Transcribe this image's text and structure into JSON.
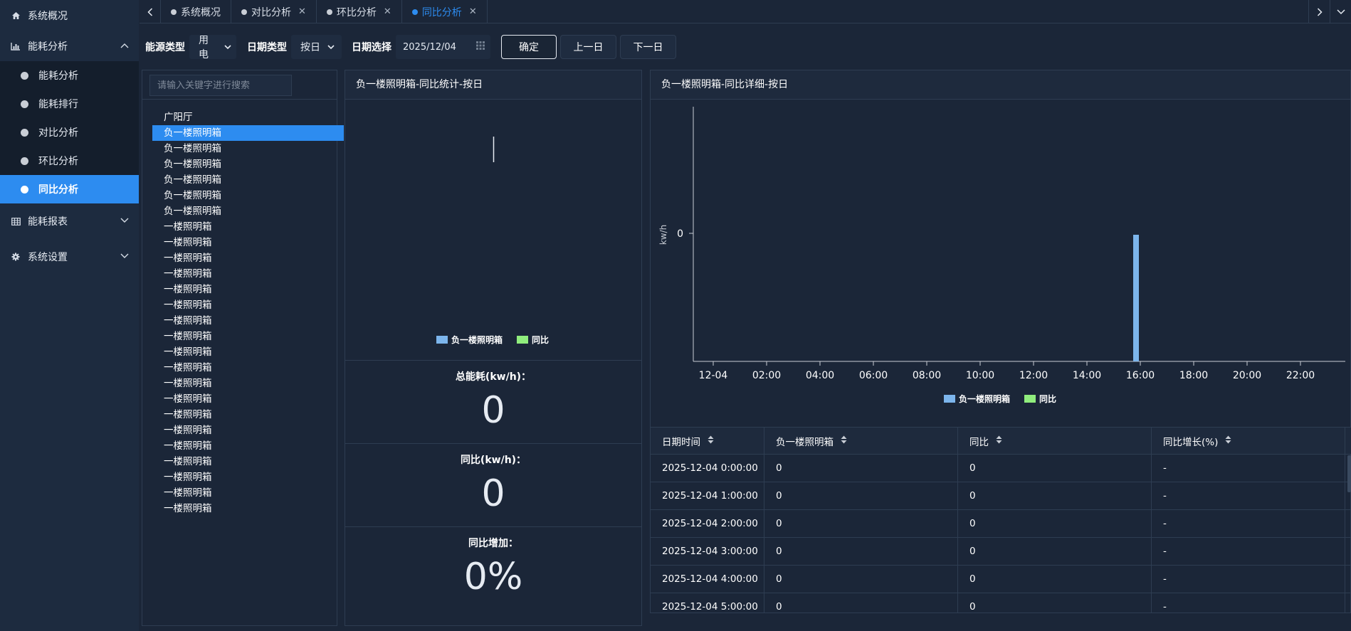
{
  "sidebar": {
    "overview": "系统概况",
    "energy_analysis": "能耗分析",
    "sub_items": [
      "能耗分析",
      "能耗排行",
      "对比分析",
      "环比分析",
      "同比分析"
    ],
    "active_sub": "同比分析",
    "report": "能耗报表",
    "settings": "系统设置",
    "icons": [
      "home-icon",
      "bar-chart-icon",
      "table-icon",
      "gear-icon"
    ]
  },
  "tabs": [
    {
      "label": "系统概况",
      "closable": false,
      "active": false
    },
    {
      "label": "对比分析",
      "closable": true,
      "active": false
    },
    {
      "label": "环比分析",
      "closable": true,
      "active": false
    },
    {
      "label": "同比分析",
      "closable": true,
      "active": true
    }
  ],
  "filters": {
    "energy_type_label": "能源类型",
    "energy_type_value": "用电",
    "date_type_label": "日期类型",
    "date_type_value": "按日",
    "date_select_label": "日期选择",
    "date_value": "2025/12/04",
    "confirm": "确定",
    "prev": "上一日",
    "next": "下一日"
  },
  "tree": {
    "search_placeholder": "请输入关键字进行搜索",
    "items": [
      "广阳厅",
      "负一楼照明箱",
      "负一楼照明箱",
      "负一楼照明箱",
      "负一楼照明箱",
      "负一楼照明箱",
      "负一楼照明箱",
      "一楼照明箱",
      "一楼照明箱",
      "一楼照明箱",
      "一楼照明箱",
      "一楼照明箱",
      "一楼照明箱",
      "一楼照明箱",
      "一楼照明箱",
      "一楼照明箱",
      "一楼照明箱",
      "一楼照明箱",
      "一楼照明箱",
      "一楼照明箱",
      "一楼照明箱",
      "一楼照明箱",
      "一楼照明箱",
      "一楼照明箱",
      "一楼照明箱",
      "一楼照明箱"
    ],
    "selected_index": 1
  },
  "stats_panel": {
    "title": "负一楼照明箱-同比统计-按日",
    "legend": [
      "负一楼照明箱",
      "同比"
    ],
    "total_label": "总能耗(kw/h)：",
    "total_value": "0",
    "yoy_label": "同比(kw/h)：",
    "yoy_value": "0",
    "increase_label": "同比增加：",
    "increase_value": "0%"
  },
  "detail_panel": {
    "title": "负一楼照明箱-同比详细-按日"
  },
  "colors": {
    "series1": "#7cb5ec",
    "series2": "#90ed7d",
    "accent": "#2d8cf0"
  },
  "chart_data": {
    "type": "bar",
    "ylabel": "kw/h",
    "yticks": [
      "0"
    ],
    "xticks": [
      "12-04",
      "02:00",
      "04:00",
      "06:00",
      "08:00",
      "10:00",
      "12:00",
      "14:00",
      "16:00",
      "18:00",
      "20:00",
      "22:00"
    ],
    "legend": "bottom-center",
    "series": [
      {
        "name": "负一楼照明箱",
        "x": "16:00",
        "value": 0
      },
      {
        "name": "同比",
        "x": "16:00",
        "value": 0
      }
    ]
  },
  "table": {
    "headers": [
      "日期时间",
      "负一楼照明箱",
      "同比",
      "同比增长(%)"
    ],
    "rows": [
      [
        "2025-12-04 0:00:00",
        "0",
        "0",
        "-"
      ],
      [
        "2025-12-04 1:00:00",
        "0",
        "0",
        "-"
      ],
      [
        "2025-12-04 2:00:00",
        "0",
        "0",
        "-"
      ],
      [
        "2025-12-04 3:00:00",
        "0",
        "0",
        "-"
      ],
      [
        "2025-12-04 4:00:00",
        "0",
        "0",
        "-"
      ],
      [
        "2025-12-04 5:00:00",
        "0",
        "0",
        "-"
      ]
    ]
  }
}
